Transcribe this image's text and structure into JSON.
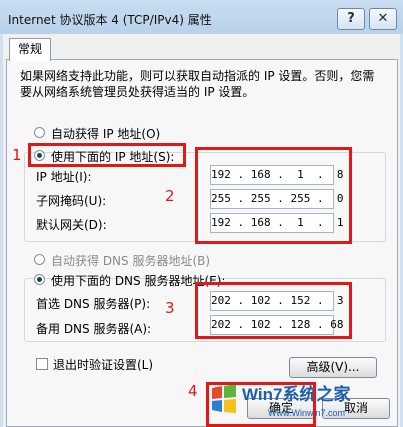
{
  "window": {
    "title": "Internet 协议版本 4 (TCP/IPv4) 属性",
    "help_btn": "?",
    "close_btn": "✕"
  },
  "tab": {
    "label": "常规"
  },
  "description": "如果网络支持此功能，则可以获取自动指派的 IP 设置。否则，您需要从网络系统管理员处获得适当的 IP 设置。",
  "ip_section": {
    "auto_label": "自动获得 IP 地址(O)",
    "manual_label": "使用下面的 IP 地址(S):",
    "selected": "manual",
    "fields": [
      {
        "label": "IP 地址(I):",
        "value": "192 . 168 .  1  .  8"
      },
      {
        "label": "子网掩码(U):",
        "value": "255 . 255 . 255 .  0"
      },
      {
        "label": "默认网关(D):",
        "value": "192 . 168 .  1  .  1"
      }
    ]
  },
  "dns_section": {
    "auto_label": "自动获得 DNS 服务器地址(B)",
    "manual_label": "使用下面的 DNS 服务器地址(E):",
    "selected": "manual",
    "fields": [
      {
        "label": "首选 DNS 服务器(P):",
        "value": "202 . 102 . 152 .  3"
      },
      {
        "label": "备用 DNS 服务器(A):",
        "value": "202 . 102 . 128 . 68"
      }
    ]
  },
  "validate_label": "退出时验证设置(L)",
  "validate_checked": false,
  "advanced_button": "高级(V)...",
  "ok_button": "确定",
  "cancel_button": "取消",
  "annotations": {
    "n1": "1",
    "n2": "2",
    "n3": "3",
    "n4": "4"
  },
  "watermark": {
    "brand": "Win7系统之家",
    "url": "Www.Winwin7.com"
  },
  "colors": {
    "annotation_red": "#e01818",
    "title_bar": "#c8dcf0",
    "dialog_bg": "#f0f0f0"
  }
}
